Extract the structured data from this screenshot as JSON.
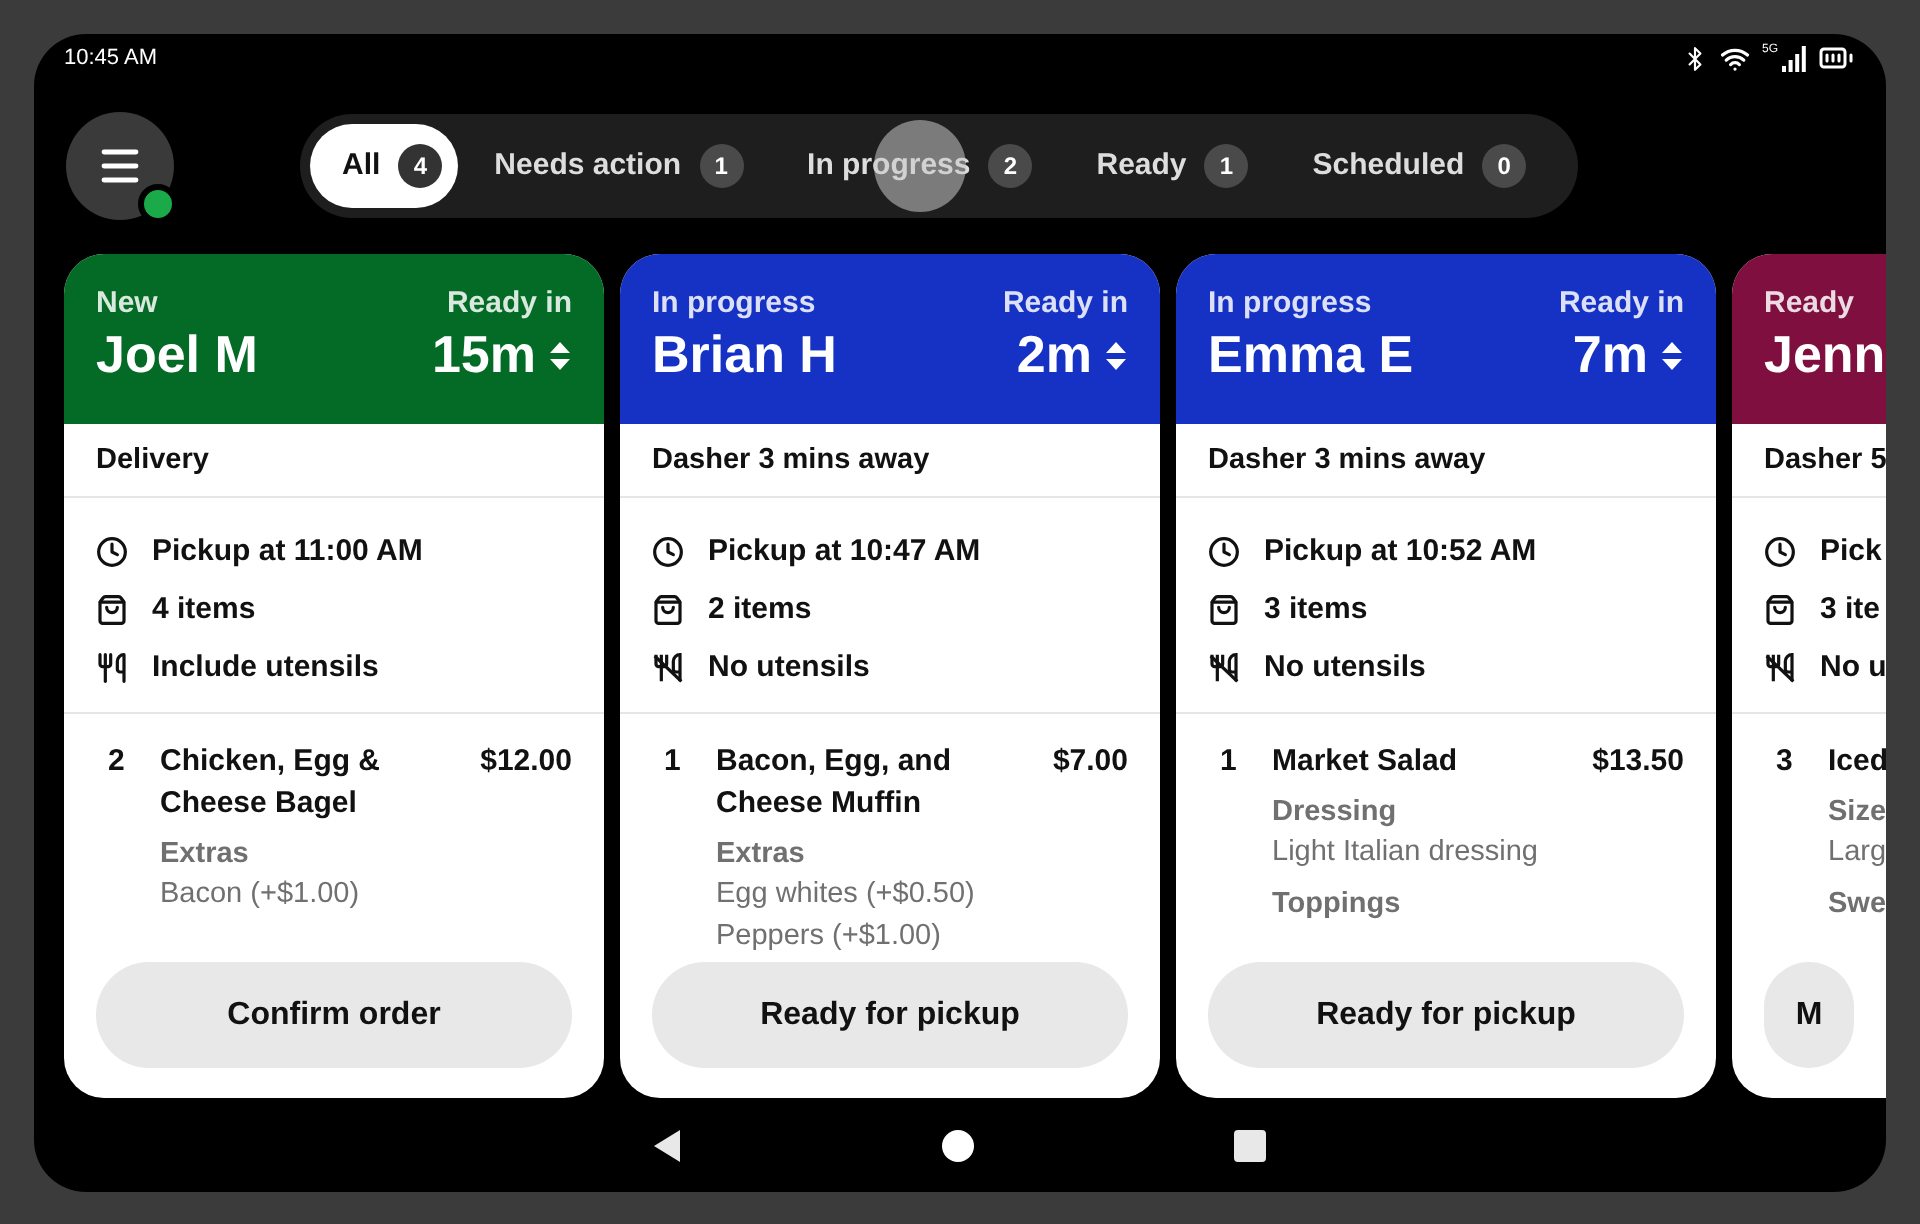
{
  "status_bar": {
    "time": "10:45 AM",
    "network": "5G"
  },
  "menu": {
    "online": true
  },
  "filters": [
    {
      "label": "All",
      "count": "4",
      "selected": true
    },
    {
      "label": "Needs action",
      "count": "1",
      "selected": false
    },
    {
      "label": "In progress",
      "count": "2",
      "selected": false,
      "touched": true
    },
    {
      "label": "Ready",
      "count": "1",
      "selected": false
    },
    {
      "label": "Scheduled",
      "count": "0",
      "selected": false
    }
  ],
  "cards": [
    {
      "status": "New",
      "customer": "Joel M",
      "color": "#036b26",
      "ready_label": "Ready in",
      "ready_time": "15m",
      "fulfillment": "Delivery",
      "info": [
        {
          "kind": "time",
          "text": "Pickup at 11:00 AM"
        },
        {
          "kind": "items",
          "text": "4 items"
        },
        {
          "kind": "utensils",
          "text": "Include utensils"
        }
      ],
      "items": [
        {
          "qty": "2",
          "name": "Chicken, Egg & Cheese Bagel",
          "price": "$12.00",
          "options": [
            {
              "label": "Extras",
              "values": [
                "Bacon (+$1.00)"
              ]
            }
          ]
        }
      ],
      "action": "Confirm order",
      "clipped": false
    },
    {
      "status": "In progress",
      "customer": "Brian H",
      "color": "#1532c4",
      "ready_label": "Ready in",
      "ready_time": "2m",
      "fulfillment": "Dasher 3 mins away",
      "info": [
        {
          "kind": "time",
          "text": "Pickup at 10:47 AM"
        },
        {
          "kind": "items",
          "text": "2 items"
        },
        {
          "kind": "no_utensils",
          "text": "No utensils"
        }
      ],
      "items": [
        {
          "qty": "1",
          "name": "Bacon, Egg, and Cheese Muffin",
          "price": "$7.00",
          "options": [
            {
              "label": "Extras",
              "values": [
                "Egg whites (+$0.50)",
                "Peppers (+$1.00)"
              ]
            }
          ]
        }
      ],
      "action": "Ready for pickup",
      "clipped": false
    },
    {
      "status": "In progress",
      "customer": "Emma E",
      "color": "#1532c4",
      "ready_label": "Ready in",
      "ready_time": "7m",
      "fulfillment": "Dasher 3 mins away",
      "info": [
        {
          "kind": "time",
          "text": "Pickup at 10:52 AM"
        },
        {
          "kind": "items",
          "text": "3 items"
        },
        {
          "kind": "no_utensils",
          "text": "No utensils"
        }
      ],
      "items": [
        {
          "qty": "1",
          "name": "Market Salad",
          "price": "$13.50",
          "options": [
            {
              "label": "Dressing",
              "values": [
                "Light Italian dressing"
              ]
            },
            {
              "label": "Toppings"
            }
          ]
        }
      ],
      "action": "Ready for pickup",
      "clipped": false
    },
    {
      "status": "Ready",
      "customer": "Jenn",
      "color": "#7e0f3f",
      "fulfillment": "Dasher 5",
      "info": [
        {
          "kind": "time",
          "text": "Pick"
        },
        {
          "kind": "items",
          "text": "3 ite"
        },
        {
          "kind": "no_utensils",
          "text": "No u"
        }
      ],
      "items": [
        {
          "qty": "3",
          "name": "Iced",
          "options": [
            {
              "label": "Size",
              "values": [
                "Larg"
              ]
            },
            {
              "label": "Swe"
            }
          ]
        }
      ],
      "action": "M",
      "clipped": true
    }
  ]
}
